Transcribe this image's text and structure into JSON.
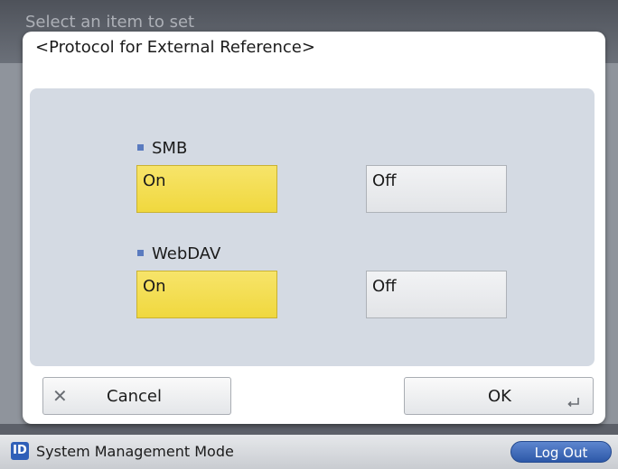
{
  "background": {
    "title": "Select an item to set"
  },
  "dialog": {
    "title": "<Protocol for External Reference>",
    "groups": [
      {
        "label": "SMB",
        "options": [
          {
            "label": "On",
            "selected": true
          },
          {
            "label": "Off",
            "selected": false
          }
        ]
      },
      {
        "label": "WebDAV",
        "options": [
          {
            "label": "On",
            "selected": true
          },
          {
            "label": "Off",
            "selected": false
          }
        ]
      }
    ],
    "cancel_label": "Cancel",
    "ok_label": "OK"
  },
  "status_bar": {
    "id_badge": "ID",
    "mode_text": "System Management Mode",
    "logout_label": "Log Out"
  },
  "colors": {
    "selected": "#f0d83e",
    "panel": "#d4dae3",
    "accent": "#2f5fb8"
  },
  "icons": {
    "cancel": "close-icon",
    "ok": "enter-return-icon",
    "bullet": "square-bullet-icon"
  }
}
